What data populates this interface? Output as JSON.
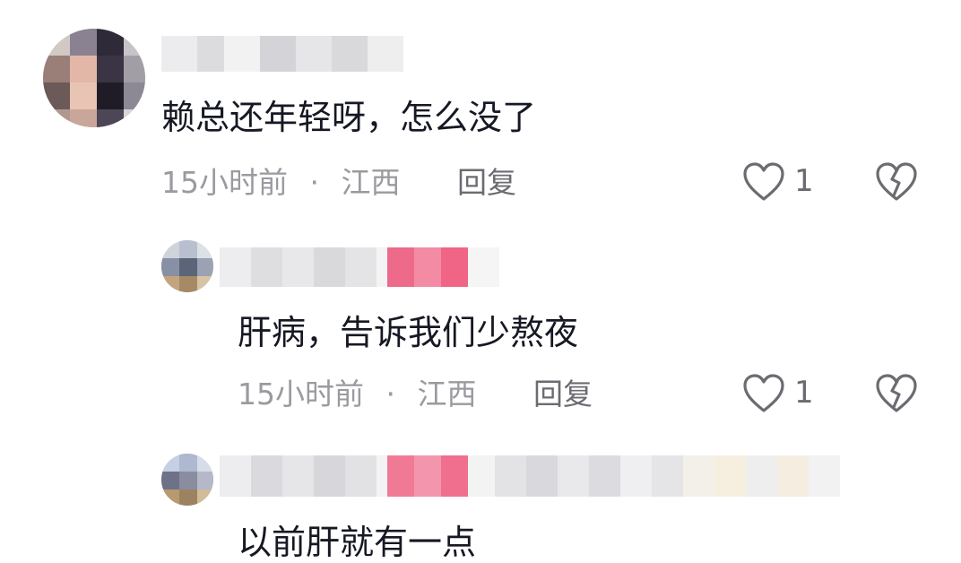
{
  "comments": [
    {
      "text": "赖总还年轻呀，怎么没了",
      "time": "15小时前",
      "separator": "·",
      "location": "江西",
      "reply_label": "回复",
      "like_count": "1"
    },
    {
      "text": "肝病，告诉我们少熬夜",
      "time": "15小时前",
      "separator": "·",
      "location": "江西",
      "reply_label": "回复",
      "like_count": "1"
    },
    {
      "text": "以前肝就有一点"
    }
  ],
  "icons": {
    "like": "heart-outline-icon",
    "dislike": "broken-heart-icon"
  },
  "colors": {
    "text": "#161823",
    "meta": "#9a9aa0",
    "action": "#6b6b72",
    "badge": "#f06486"
  }
}
